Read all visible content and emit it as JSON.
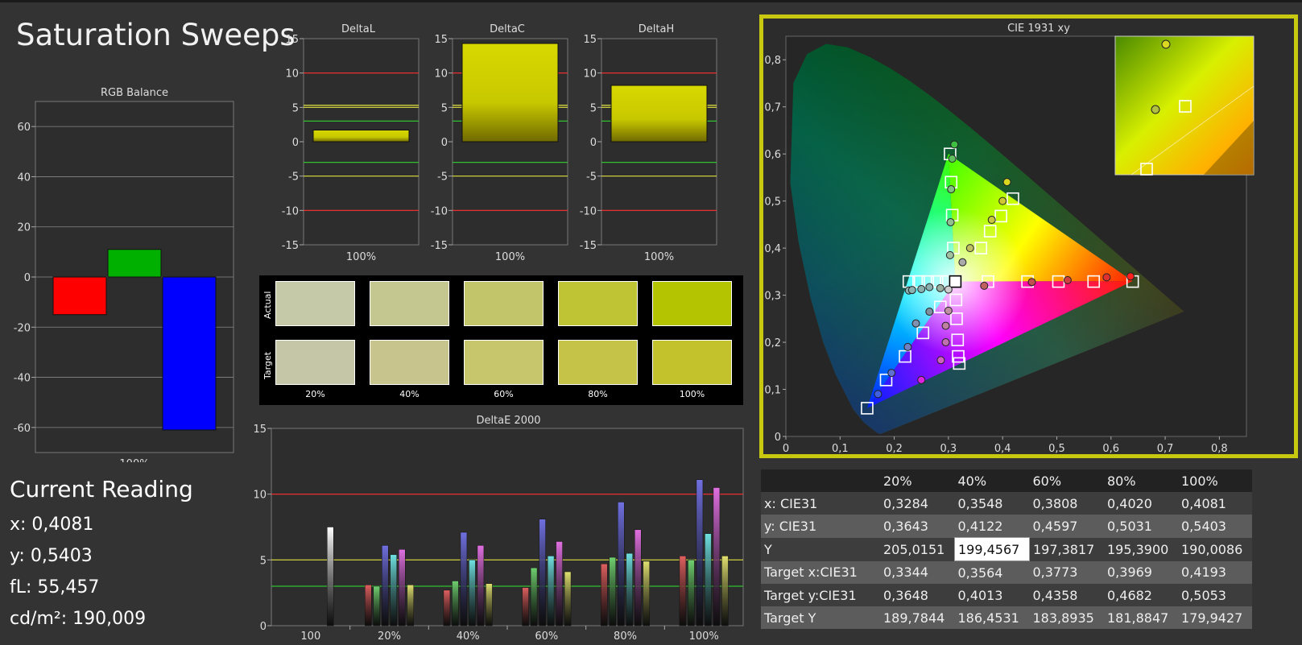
{
  "title": "Saturation Sweeps",
  "colors": {
    "red": "#ff0000",
    "green": "#00b000",
    "blue": "#0000ff",
    "yellow": "#d8d800",
    "frame": "#c8c810"
  },
  "chart_data": [
    {
      "id": "rgb_balance",
      "type": "bar",
      "title": "RGB Balance",
      "categories": [
        "100%"
      ],
      "series": [
        {
          "name": "R",
          "color": "#ff0000",
          "values": [
            -15
          ]
        },
        {
          "name": "G",
          "color": "#00b000",
          "values": [
            11
          ]
        },
        {
          "name": "B",
          "color": "#0000ff",
          "values": [
            -61
          ]
        }
      ],
      "ylim": [
        -70,
        70
      ],
      "yticks": [
        "60",
        "40",
        "20",
        "0",
        "-20",
        "-40",
        "-60"
      ],
      "grid": true
    },
    {
      "id": "deltaL",
      "type": "bar",
      "title": "DeltaL",
      "categories": [
        "100%"
      ],
      "values": [
        1.7
      ],
      "ylim": [
        -15,
        15
      ],
      "yticks": [
        "15",
        "10",
        "5",
        "0",
        "-5",
        "-10",
        "-15"
      ]
    },
    {
      "id": "deltaC",
      "type": "bar",
      "title": "DeltaC",
      "categories": [
        "100%"
      ],
      "values": [
        14.3
      ],
      "ylim": [
        -15,
        15
      ],
      "yticks": [
        "15",
        "10",
        "5",
        "0",
        "-5",
        "-10",
        "-15"
      ]
    },
    {
      "id": "deltaH",
      "type": "bar",
      "title": "DeltaH",
      "categories": [
        "100%"
      ],
      "values": [
        8.2
      ],
      "ylim": [
        -15,
        15
      ],
      "yticks": [
        "15",
        "10",
        "5",
        "0",
        "-5",
        "-10",
        "-15"
      ]
    },
    {
      "id": "deltaE2000",
      "type": "bar",
      "title": "DeltaE 2000",
      "categories": [
        "100",
        "20%",
        "40%",
        "60%",
        "80%",
        "100%"
      ],
      "series": [
        {
          "name": "W",
          "color": "#ffffff",
          "values": [
            7.5,
            null,
            null,
            null,
            null,
            null
          ]
        },
        {
          "name": "R",
          "color": "#e06060",
          "values": [
            null,
            3.1,
            2.7,
            2.9,
            4.7,
            5.3
          ]
        },
        {
          "name": "G",
          "color": "#70d070",
          "values": [
            null,
            3.0,
            3.4,
            4.4,
            5.2,
            5.0
          ]
        },
        {
          "name": "B",
          "color": "#7070e0",
          "values": [
            null,
            6.1,
            7.1,
            8.1,
            9.4,
            11.1
          ]
        },
        {
          "name": "C",
          "color": "#70e0e0",
          "values": [
            null,
            5.4,
            5.0,
            5.3,
            5.5,
            7.0
          ]
        },
        {
          "name": "M",
          "color": "#e070e0",
          "values": [
            null,
            5.8,
            6.1,
            6.4,
            7.3,
            10.5
          ]
        },
        {
          "name": "Y",
          "color": "#e0e070",
          "values": [
            null,
            3.1,
            3.2,
            4.1,
            4.9,
            5.3
          ]
        }
      ],
      "ylim": [
        0,
        15
      ],
      "yticks": [
        "15",
        "10",
        "5",
        "0"
      ]
    },
    {
      "id": "cie1931",
      "type": "scatter",
      "title": "CIE 1931 xy",
      "xlim": [
        0,
        0.85
      ],
      "ylim": [
        0,
        0.85
      ],
      "xticks": [
        "0",
        "0,1",
        "0,2",
        "0,3",
        "0,4",
        "0,5",
        "0,6",
        "0,7",
        "0,8"
      ],
      "yticks": [
        "0,8",
        "0,7",
        "0,6",
        "0,5",
        "0,4",
        "0,3",
        "0,2",
        "0,1",
        "0"
      ],
      "targets": [
        [
          0.3127,
          0.329
        ],
        [
          0.296,
          0.329
        ],
        [
          0.279,
          0.329
        ],
        [
          0.262,
          0.329
        ],
        [
          0.245,
          0.329
        ],
        [
          0.227,
          0.329
        ],
        [
          0.3127,
          0.329
        ],
        [
          0.373,
          0.329
        ],
        [
          0.446,
          0.329
        ],
        [
          0.503,
          0.329
        ],
        [
          0.568,
          0.329
        ],
        [
          0.64,
          0.329
        ],
        [
          0.3127,
          0.329
        ],
        [
          0.309,
          0.4
        ],
        [
          0.307,
          0.47
        ],
        [
          0.305,
          0.54
        ],
        [
          0.303,
          0.6
        ],
        [
          0.3127,
          0.329
        ],
        [
          0.314,
          0.29
        ],
        [
          0.315,
          0.25
        ],
        [
          0.317,
          0.205
        ],
        [
          0.318,
          0.17
        ],
        [
          0.32,
          0.155
        ],
        [
          0.3127,
          0.329
        ],
        [
          0.285,
          0.275
        ],
        [
          0.253,
          0.22
        ],
        [
          0.22,
          0.17
        ],
        [
          0.185,
          0.12
        ],
        [
          0.15,
          0.06
        ],
        [
          0.3127,
          0.329
        ],
        [
          0.36,
          0.4
        ],
        [
          0.377,
          0.436
        ],
        [
          0.397,
          0.468
        ],
        [
          0.419,
          0.505
        ]
      ],
      "measured": [
        {
          "x": 0.227,
          "y": 0.31,
          "c": "#8ab0b0"
        },
        {
          "x": 0.233,
          "y": 0.311,
          "c": "#8ab0b0"
        },
        {
          "x": 0.25,
          "y": 0.313,
          "c": "#8ab0b0"
        },
        {
          "x": 0.265,
          "y": 0.317,
          "c": "#8ab0b0"
        },
        {
          "x": 0.285,
          "y": 0.315,
          "c": "#9ab0a0"
        },
        {
          "x": 0.3,
          "y": 0.312,
          "c": "#cccccc"
        },
        {
          "x": 0.326,
          "y": 0.37,
          "c": "#aaaaaa"
        },
        {
          "x": 0.366,
          "y": 0.32,
          "c": "#c06060"
        },
        {
          "x": 0.454,
          "y": 0.328,
          "c": "#c05050"
        },
        {
          "x": 0.52,
          "y": 0.332,
          "c": "#d04040"
        },
        {
          "x": 0.592,
          "y": 0.338,
          "c": "#e03030"
        },
        {
          "x": 0.636,
          "y": 0.34,
          "c": "#ff2020"
        },
        {
          "x": 0.303,
          "y": 0.385,
          "c": "#a0c0a0"
        },
        {
          "x": 0.304,
          "y": 0.455,
          "c": "#90c090"
        },
        {
          "x": 0.305,
          "y": 0.525,
          "c": "#80c080"
        },
        {
          "x": 0.307,
          "y": 0.59,
          "c": "#60c060"
        },
        {
          "x": 0.311,
          "y": 0.62,
          "c": "#40c040"
        },
        {
          "x": 0.3,
          "y": 0.267,
          "c": "#c090a0"
        },
        {
          "x": 0.295,
          "y": 0.235,
          "c": "#c080a0"
        },
        {
          "x": 0.295,
          "y": 0.2,
          "c": "#c070b0"
        },
        {
          "x": 0.286,
          "y": 0.162,
          "c": "#d060c0"
        },
        {
          "x": 0.25,
          "y": 0.12,
          "c": "#e020e0"
        },
        {
          "x": 0.265,
          "y": 0.265,
          "c": "#8090a0"
        },
        {
          "x": 0.24,
          "y": 0.24,
          "c": "#8090b0"
        },
        {
          "x": 0.225,
          "y": 0.19,
          "c": "#7080c0"
        },
        {
          "x": 0.195,
          "y": 0.135,
          "c": "#6070d0"
        },
        {
          "x": 0.17,
          "y": 0.09,
          "c": "#4060e0"
        },
        {
          "x": 0.34,
          "y": 0.4,
          "c": "#c0c060"
        },
        {
          "x": 0.38,
          "y": 0.46,
          "c": "#c8c840"
        },
        {
          "x": 0.4,
          "y": 0.5,
          "c": "#d0c830"
        },
        {
          "x": 0.4081,
          "y": 0.5403,
          "c": "#d8d820"
        }
      ]
    }
  ],
  "swatches": {
    "row_labels": [
      "Actual",
      "Target"
    ],
    "labels": [
      "20%",
      "40%",
      "60%",
      "80%",
      "100%"
    ],
    "actual_colors": [
      "#c5c9a8",
      "#c4c78f",
      "#c3c56b",
      "#bfc435",
      "#b5c400"
    ],
    "target_colors": [
      "#c5c6a8",
      "#c7c58d",
      "#c8c66c",
      "#c5c448",
      "#c3c22c"
    ]
  },
  "current_reading": {
    "heading": "Current Reading",
    "x": "x: 0,4081",
    "y": "y: 0,5403",
    "fl": "fL: 55,457",
    "cdm2": "cd/m²: 190,009"
  },
  "table": {
    "headers": [
      "",
      "20%",
      "40%",
      "60%",
      "80%",
      "100%"
    ],
    "rows": [
      [
        "x: CIE31",
        "0,3284",
        "0,3548",
        "0,3808",
        "0,4020",
        "0,4081"
      ],
      [
        "y: CIE31",
        "0,3643",
        "0,4122",
        "0,4597",
        "0,5031",
        "0,5403"
      ],
      [
        "Y",
        "205,0151",
        "199,4567",
        "197,3817",
        "195,3900",
        "190,0086"
      ],
      [
        "Target x:CIE31",
        "0,3344",
        "0,3564",
        "0,3773",
        "0,3969",
        "0,4193"
      ],
      [
        "Target y:CIE31",
        "0,3648",
        "0,4013",
        "0,4358",
        "0,4682",
        "0,5053"
      ],
      [
        "Target Y",
        "189,7844",
        "186,4531",
        "183,8935",
        "181,8847",
        "179,9427"
      ]
    ]
  }
}
